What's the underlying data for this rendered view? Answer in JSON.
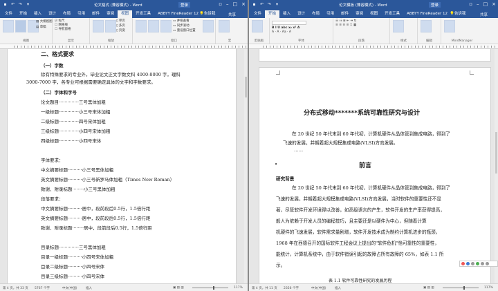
{
  "left_window": {
    "title": "论文格式 (兼容模式) - Word",
    "login": "登录",
    "share": "共享",
    "tell_me": "告诉我",
    "tabs": [
      "文件",
      "开始",
      "插入",
      "设计",
      "布局",
      "引用",
      "邮件",
      "审阅",
      "视图",
      "开发工具",
      "ABBYY FineReader 12"
    ],
    "active_tab": "视图",
    "ribbon": {
      "groups": [
        "视图",
        "显示",
        "缩放",
        "窗口",
        "宏"
      ],
      "views": [
        "阅读视图",
        "页面视图",
        "Web 版式视图",
        "大纲视图",
        "草稿"
      ],
      "show": [
        "标尺",
        "网格线",
        "导航窗格"
      ],
      "zoom": [
        "缩放",
        "100%",
        "单页",
        "多页",
        "页宽"
      ],
      "window": [
        "新建窗口",
        "全部重排",
        "拆分",
        "并排查看",
        "同步滚动",
        "重设窗口位置",
        "切换窗口"
      ],
      "macro": "宏"
    },
    "doc": {
      "h2": "二、格式要求",
      "s1": "（一）字数",
      "p1_line1": "除有特殊要求的专业外，毕业论文正文字数文科 4000-8000 字，理科",
      "p1_line2": "3000-7000 字，各专业可根据需要确定具体的文字和字数要求。",
      "s2": "（二）字体和字号",
      "lines": [
        "论文题目··············三号黑体加粗",
        "一级标题··············小三号宋体加粗",
        "二级标题··············四号宋体加粗",
        "三级标题··············小四号宋体加粗",
        "四级标题··············小四号宋体",
        "",
        "字体要求：",
        "中文摘要标题··········小三号黑体加粗",
        "英文摘要标题··········小三号新罗马体加粗（Times New Roman）",
        "致谢、附录标题········小三号黑体加粗",
        "段落要求：",
        "中文摘要标题··········居中，段前段后0.5行，1.5倍行距",
        "英文摘要标题··········居中，段前段后0.5行，1.5倍行距",
        "致谢、附录标题········居中，段前段后0.5行，1.5倍行距",
        "",
        "目录标题··············三号黑体加粗",
        "目录一级标题··········小四号宋体加粗",
        "目录二级标题··········小四号宋体",
        "目录三级标题··········小四号宋体"
      ]
    },
    "status": {
      "page": "第 4 页，共 33 页",
      "words": "5767 个字",
      "lang": "中文(中国)",
      "mode": "插入",
      "zoom": "117%"
    }
  },
  "right_window": {
    "title": "论文模板 (兼容模式) - Word",
    "login": "登录",
    "share": "共享",
    "tell_me": "告诉我",
    "tabs": [
      "文件",
      "开始",
      "插入",
      "设计",
      "布局",
      "引用",
      "邮件",
      "审阅",
      "视图",
      "开发工具",
      "ABBYY FineReader 12"
    ],
    "active_tab": "开始",
    "ribbon": {
      "groups": [
        "剪贴板",
        "字体",
        "段落",
        "样式",
        "编辑",
        "MindManager"
      ],
      "styles_label": "样式",
      "edit_label": "编辑",
      "mm_label": "发送到 MindManager"
    },
    "doc": {
      "title": "分布式移动*******系统可靠性研究与设计",
      "intro_line1": "在 20 世纪 50 年代末到 60 年代初，计算机硬件从晶体管到集成电路，得到了",
      "intro_line2": "飞速的发展，并朝着超大规模集成电路(VLSI)方向发展。",
      "intro_line3": "……",
      "preface": "前言",
      "background": "研究背景",
      "para": [
        "在 20 世纪 50 年代末到 60 年代初，计算机硬件从晶体管到集成电路，得到了",
        "飞速的发展，并朝着超大规模集成电路(VLSI)方向发展，当时软件的重要性还不显",
        "著，尽管软件开发环境得以改善，如高级语言的产生，软件开发的生产率获得提高，",
        "般人为依赖于开发人员的编程技巧，且主要还是以硬件为中心，但随着计算",
        "机硬件的飞速发展，软件需求量剧增，软件开发技术成为制约计算机进步的瓶颈，",
        "1968 年在西德召开的国际软件工程会议上提出的\"软件危机\"恰可靠性的重要性，",
        "能统计，计算机系统中，由于软件错误引起的故障占所有故障的 65%，如表 1.1 所",
        "示。"
      ],
      "table_caption": "表 1.1  软件可靠性研究的发展历程"
    },
    "status": {
      "page": "第 4 页，共 11 页",
      "words": "2356 个字",
      "lang": "中文(中国)",
      "mode": "插入",
      "zoom": "117%"
    }
  },
  "colors": {
    "title_bar": "#2b579a",
    "ribbon": "#f3f3f3",
    "canvas": "#e6e6e6",
    "page": "#ffffff"
  }
}
